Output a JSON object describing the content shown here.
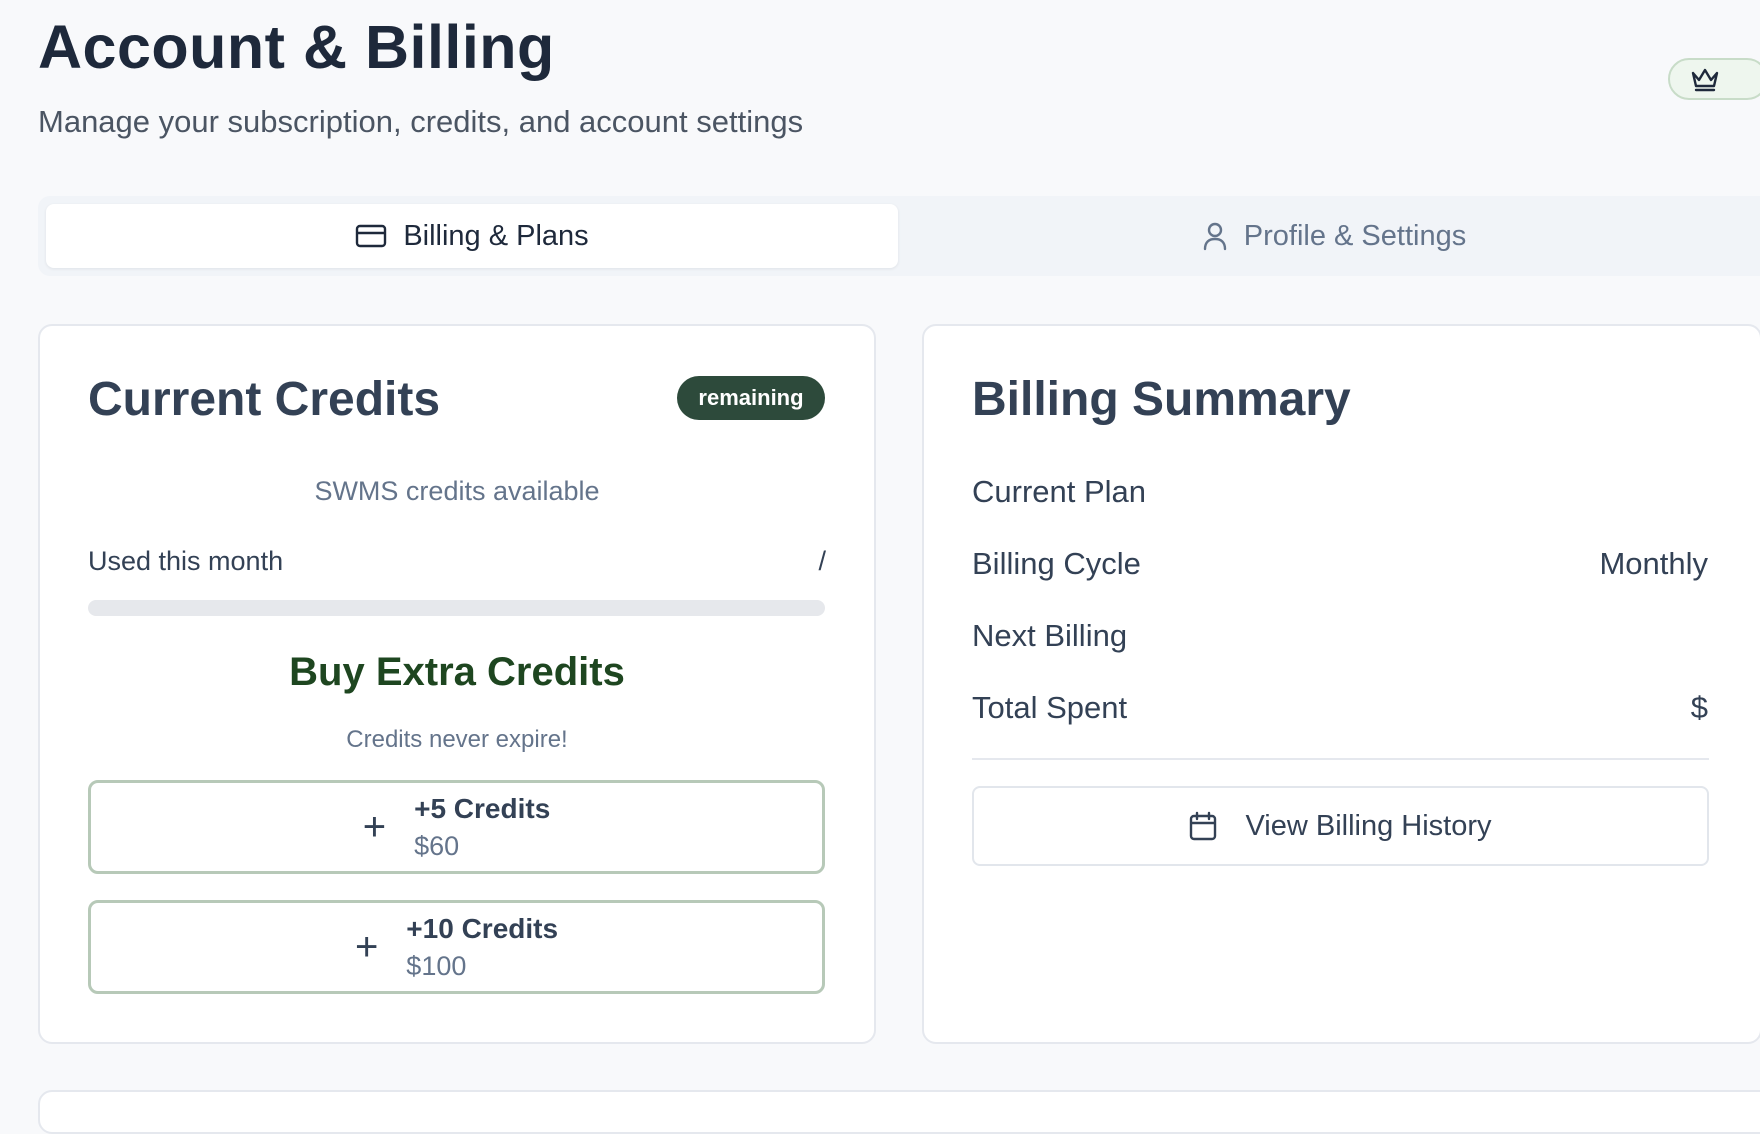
{
  "header": {
    "title": "Account & Billing",
    "subtitle": "Manage your subscription, credits, and account settings",
    "plan_badge_icon": "crown-icon"
  },
  "tabs": [
    {
      "label": "Billing & Plans",
      "icon": "credit-card-icon",
      "active": true
    },
    {
      "label": "Profile & Settings",
      "icon": "user-icon",
      "active": false
    }
  ],
  "credits": {
    "title": "Current Credits",
    "badge": "remaining",
    "available_label": "SWMS credits available",
    "used_label": "Used this month",
    "used_value": "/",
    "progress_fraction": 0,
    "buy_title": "Buy Extra Credits",
    "buy_subtitle": "Credits never expire!",
    "options": [
      {
        "amount": "+5 Credits",
        "price": "$60"
      },
      {
        "amount": "+10 Credits",
        "price": "$100"
      }
    ]
  },
  "billing": {
    "title": "Billing Summary",
    "rows": [
      {
        "label": "Current Plan",
        "value": ""
      },
      {
        "label": "Billing Cycle",
        "value": "Monthly"
      },
      {
        "label": "Next Billing",
        "value": ""
      },
      {
        "label": "Total Spent",
        "value": "$"
      }
    ],
    "history_button": "View Billing History"
  },
  "colors": {
    "accent_dark_green": "#2d4a3b",
    "buy_title_green": "#1e4620",
    "option_border": "#b7c9b8",
    "background": "#f8f9fb"
  }
}
